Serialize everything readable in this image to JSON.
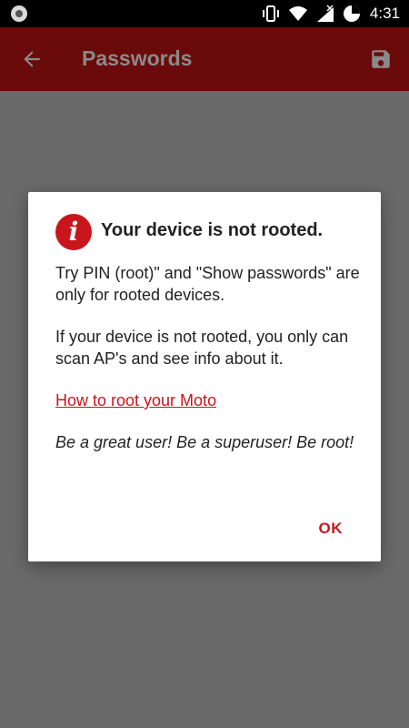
{
  "status_bar": {
    "time": "4:31",
    "icons": [
      "circle-app-icon",
      "vibrate-icon",
      "wifi-icon",
      "signal-off-icon",
      "battery-icon"
    ]
  },
  "app_bar": {
    "title": "Passwords",
    "back_icon": "arrow-left",
    "save_icon": "save-floppy"
  },
  "dialog": {
    "icon": "info-i",
    "title": "Your device is not rooted.",
    "paragraphs": [
      "Try PIN (root)\" and \"Show passwords\" are only for rooted devices.",
      "If your device is not rooted, you only can scan AP's and see info about it."
    ],
    "link_text": "How to root your Moto",
    "closing_text": "Be a great user! Be a superuser! Be root!",
    "ok_label": "OK"
  },
  "colors": {
    "app_bar": "#6b0a0a",
    "accent": "#c9161c",
    "overlay": "#6a6a6a"
  }
}
